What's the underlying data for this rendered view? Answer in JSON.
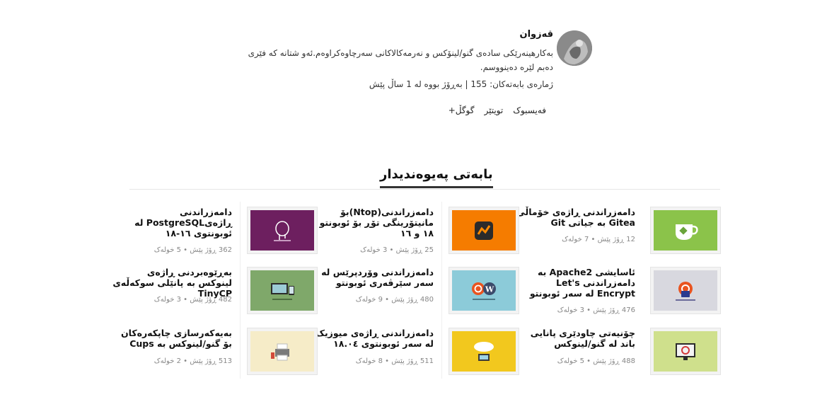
{
  "author": {
    "name": "قەزوان",
    "bio": "بەکارهینەرێکی سادەی گنو/لینۆکس و نەرمەکالاکانی سەرچاوەکراوەم.ئەو شتانە کە فێری دەبم لێرە دەینووسم.",
    "stats": "ژمارەی بابەتەکان: 155 | بەڕۆژ بووە لە 1 ساڵ پێش",
    "social": [
      "فەیسبوک",
      "تویتێر",
      "گوگڵ+"
    ]
  },
  "related": {
    "title": "بابەتی پەیوەندیدار",
    "posts": [
      {
        "title": "دامەزراندنی ڕاژەی خۆماڵی Gitea بە جیاتی Git",
        "meta": "12 ڕۆژ پێش  •  7 خولەک",
        "thumb_color": "#8bc34a"
      },
      {
        "title": "دامەزراندنی(Ntop)بۆ مانیتۆرینگی تۆڕ بۆ ئوبونتو ١٨ و ١٦",
        "meta": "25 ڕۆژ پێش  •  3 خولەک",
        "thumb_color": "#f57c00"
      },
      {
        "title": "دامەزراندنی ڕاژەیPostgreSQL لە ئوبونتوی ١٦-١٨",
        "meta": "362 ڕۆژ پێش  •  5 خولەک",
        "thumb_color": "#6d1f5f"
      },
      {
        "title": "ئاسایشی Apache2 بە دامەزراندنی Let's Encrypt لە سەر ئوبونتو",
        "meta": "476 ڕۆژ پێش  •  3 خولەک",
        "thumb_color": "#d8d8df"
      },
      {
        "title": "دامەزراندنی وۆردپرێس لە سەر سێرڤەری ئوبونتو",
        "meta": "480 ڕۆژ پێش  •  9 خولەک",
        "thumb_color": "#8ccbd9"
      },
      {
        "title": "بەڕێوەبردنی ڕاژەی لینوکس بە پانێلی سوکەڵەی TinyCP",
        "meta": "482 ڕۆژ پێش  •  3 خولەک",
        "thumb_color": "#7fa86a"
      },
      {
        "title": "چۆنیەتی چاودێری پانایی باند لە گنو/لینوکس",
        "meta": "488 ڕۆژ پێش  •  5 خولەک",
        "thumb_color": "#cfe08c"
      },
      {
        "title": "دامەزراندنی ڕاژەی میوزیک لە سەر ئوبونتوی ١٨.٠٤",
        "meta": "511 ڕۆژ پێش  •  8 خولەک",
        "thumb_color": "#f2c81e"
      },
      {
        "title": "بەیەکەرسازی چاپکەرەکان بۆ گنو/لینوکس بە Cups",
        "meta": "513 ڕۆژ پێش  •  2 خولەک",
        "thumb_color": "#f6ecc8"
      }
    ]
  }
}
